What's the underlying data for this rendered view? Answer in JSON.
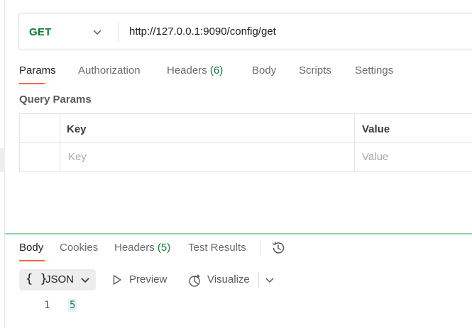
{
  "request": {
    "method": "GET",
    "url": "http://127.0.0.1:9090/config/get",
    "tabs": [
      {
        "label": "Params",
        "count": ""
      },
      {
        "label": "Authorization",
        "count": ""
      },
      {
        "label": "Headers",
        "count": "(6)"
      },
      {
        "label": "Body",
        "count": ""
      },
      {
        "label": "Scripts",
        "count": ""
      },
      {
        "label": "Settings",
        "count": ""
      }
    ],
    "active_tab": "Params"
  },
  "query_params": {
    "title": "Query Params",
    "columns": [
      "Key",
      "Value"
    ],
    "placeholder_row": {
      "key": "Key",
      "value": "Value"
    }
  },
  "response": {
    "tabs": [
      {
        "label": "Body",
        "count": ""
      },
      {
        "label": "Cookies",
        "count": ""
      },
      {
        "label": "Headers",
        "count": "(5)"
      },
      {
        "label": "Test Results",
        "count": ""
      }
    ],
    "active_tab": "Body",
    "format": {
      "braces": "{ }",
      "label": "JSON"
    },
    "preview_label": "Preview",
    "visualize_label": "Visualize",
    "body_lines": [
      {
        "num": "1",
        "value": "5"
      }
    ]
  },
  "colors": {
    "method_green": "#0b7a35",
    "active_underline": "#f26b3a",
    "divider_green": "#8fd3a8"
  },
  "icons": [
    "chevron-down-icon",
    "history-icon",
    "play-icon",
    "visualize-icon"
  ]
}
